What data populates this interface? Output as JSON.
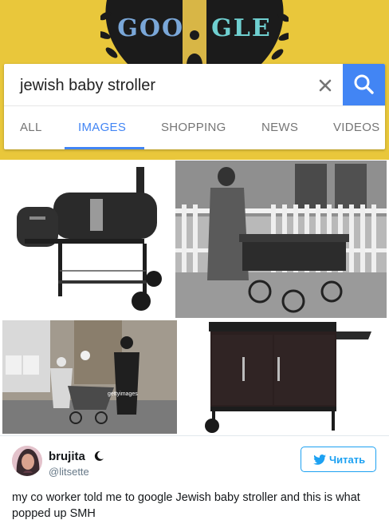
{
  "doodle": {
    "logo_left": "GOO",
    "logo_right": "GLE"
  },
  "search": {
    "query": "jewish baby stroller",
    "clear_icon": "close-icon",
    "search_icon": "search-icon"
  },
  "tabs": [
    {
      "label": "ALL",
      "active": false
    },
    {
      "label": "IMAGES",
      "active": true
    },
    {
      "label": "SHOPPING",
      "active": false
    },
    {
      "label": "NEWS",
      "active": false
    },
    {
      "label": "VIDEOS",
      "active": false
    }
  ],
  "results": {
    "watermark": "gettyimages"
  },
  "tweet": {
    "name": "brujita",
    "handle": "@litsette",
    "follow_label": "Читать",
    "text": "my co worker told me to google Jewish baby stroller and this is what popped up SMH",
    "colors": {
      "accent": "#1da1f2",
      "google_blue": "#4285f4",
      "doodle_yellow": "#e9c73b"
    }
  }
}
